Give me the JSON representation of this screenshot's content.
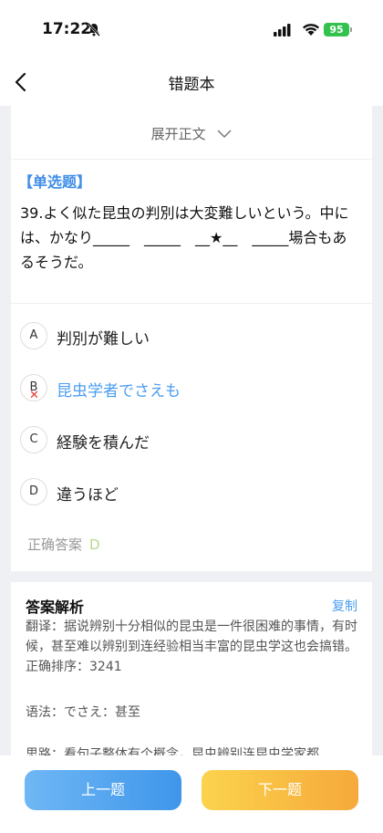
{
  "status": {
    "time": "17:22",
    "battery": "95"
  },
  "nav": {
    "title": "错题本"
  },
  "expand": {
    "label": "展开正文"
  },
  "question": {
    "type": "【单选题】",
    "text": "39.よく似た昆虫の判別は大変難しいという。中には、かなり_____　_____　__★__　_____場合もあるそうだ。"
  },
  "options": [
    {
      "letter": "A",
      "text": "判別が難しい"
    },
    {
      "letter": "B",
      "text": "昆虫学者でさえも",
      "wrong_mark": "✕"
    },
    {
      "letter": "C",
      "text": "経験を積んだ"
    },
    {
      "letter": "D",
      "text": "違うほど"
    }
  ],
  "answer": {
    "label": "正确答案",
    "value": "D"
  },
  "analysis": {
    "title": "答案解析",
    "copy": "复制",
    "translation": "翻译：据说辨别十分相似的昆虫是一件很困难的事情，有时候，甚至难以辨别到连经验相当丰富的昆虫学这也会搞错。正确排序：3241",
    "grammar": "语法：でさえ：甚至",
    "thinking": "思路：看句子整体有个概念，昆虫辨别连昆虫学家都"
  },
  "footer": {
    "prev": "上一题",
    "next": "下一题"
  },
  "colors": {
    "accent": "#3f8ee8",
    "wrong": "#e53935",
    "answer": "#b7d98a"
  }
}
